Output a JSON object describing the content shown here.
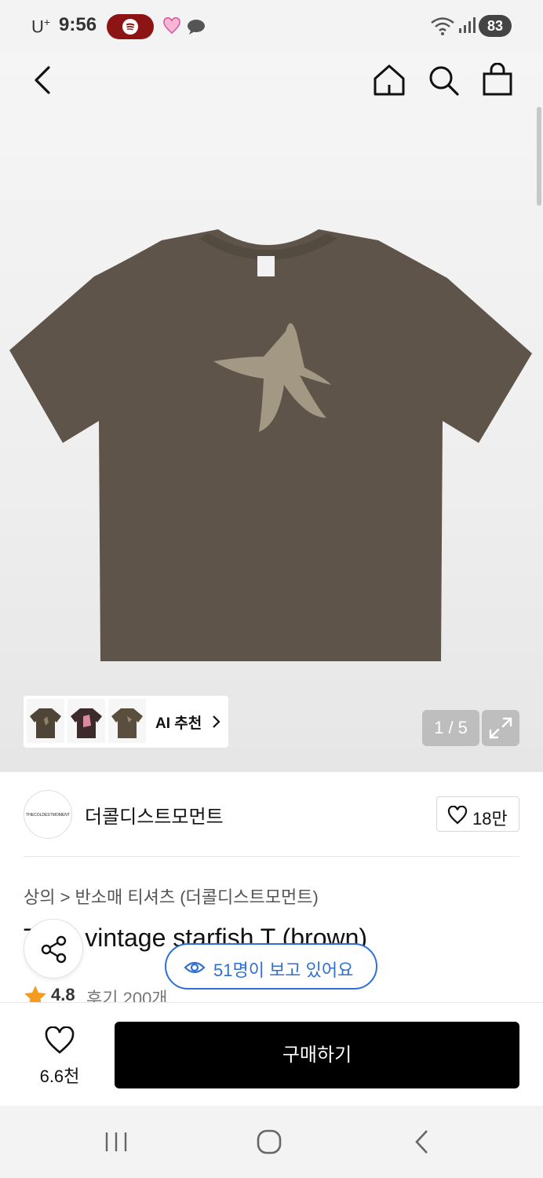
{
  "status_bar": {
    "carrier": "U",
    "carrier_sup": "+",
    "time": "9:56",
    "battery": "83"
  },
  "header": {
    "icons": [
      "back-icon",
      "home-icon",
      "search-icon",
      "bag-icon"
    ]
  },
  "gallery": {
    "ai_label": "AI 추천",
    "pager": "1 / 5",
    "thumbnail_count": 3
  },
  "brand": {
    "logo_text": "THECOLDESTMOMENT",
    "name": "더콜디스트모먼트",
    "likes": "18만"
  },
  "product": {
    "category": "상의 > 반소매 티셔츠 (더콜디스트모먼트)",
    "title": "TCM vintage starfish T (brown)",
    "rating": "4.8",
    "reviews": "후기 200개",
    "viewers": "51명이 보고 있어요"
  },
  "bottom_bar": {
    "favorite_count": "6.6천",
    "buy_label": "구매하기"
  },
  "colors": {
    "shirt": "#5e5449",
    "starfish": "#a29883",
    "accent_blue": "#2f6fd6",
    "star": "#f39c1f"
  }
}
